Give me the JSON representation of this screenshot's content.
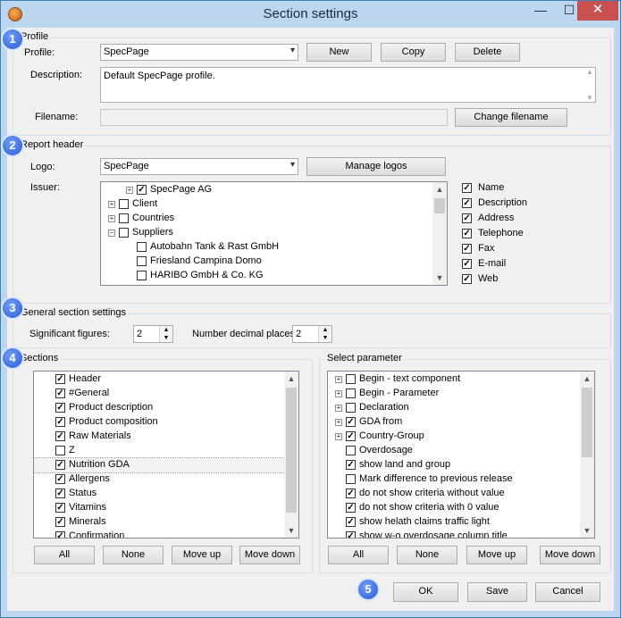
{
  "window": {
    "title": "Section settings",
    "minimize": "—",
    "maximize": "☐",
    "close": "✕"
  },
  "badges": [
    "1",
    "2",
    "3",
    "4",
    "5"
  ],
  "profile": {
    "group_label": "Profile",
    "profile_label": "Profile:",
    "profile_value": "SpecPage",
    "new_label": "New",
    "copy_label": "Copy",
    "delete_label": "Delete",
    "description_label": "Description:",
    "description_value": "Default SpecPage profile.",
    "filename_label": "Filename:",
    "filename_value": "",
    "change_filename_label": "Change filename"
  },
  "report_header": {
    "group_label": "Report header",
    "logo_label": "Logo:",
    "logo_value": "SpecPage",
    "manage_logos_label": "Manage logos",
    "issuer_label": "Issuer:",
    "issuer_tree": [
      {
        "label": "SpecPage AG",
        "checked": true,
        "expander": "+",
        "indent": 1
      },
      {
        "label": "Client",
        "checked": false,
        "expander": "+",
        "indent": 0
      },
      {
        "label": "Countries",
        "checked": false,
        "expander": "+",
        "indent": 0
      },
      {
        "label": "Suppliers",
        "checked": false,
        "expander": "−",
        "indent": 0
      },
      {
        "label": "Autobahn Tank & Rast GmbH",
        "checked": false,
        "expander": "",
        "indent": 1
      },
      {
        "label": "Friesland Campina Domo",
        "checked": false,
        "expander": "",
        "indent": 1
      },
      {
        "label": "HARIBO GmbH & Co. KG",
        "checked": false,
        "expander": "",
        "indent": 1
      }
    ],
    "fields": [
      {
        "label": "Name",
        "checked": true
      },
      {
        "label": "Description",
        "checked": true
      },
      {
        "label": "Address",
        "checked": true
      },
      {
        "label": "Telephone",
        "checked": true
      },
      {
        "label": "Fax",
        "checked": true
      },
      {
        "label": "E-mail",
        "checked": true
      },
      {
        "label": "Web",
        "checked": true
      }
    ]
  },
  "general": {
    "group_label": "General section settings",
    "sig_label": "Significant figures:",
    "sig_value": "2",
    "dec_label": "Number decimal places:",
    "dec_value": "2"
  },
  "sections": {
    "group_label": "Sections",
    "items": [
      {
        "label": "Header",
        "checked": true
      },
      {
        "label": "#General",
        "checked": true
      },
      {
        "label": "Product description",
        "checked": true
      },
      {
        "label": "Product composition",
        "checked": true
      },
      {
        "label": "Raw Materials",
        "checked": true
      },
      {
        "label": "Z",
        "checked": false
      },
      {
        "label": "Nutrition GDA",
        "checked": true,
        "selected": true
      },
      {
        "label": "Allergens",
        "checked": true
      },
      {
        "label": "Status",
        "checked": true
      },
      {
        "label": "Vitamins",
        "checked": true
      },
      {
        "label": "Minerals",
        "checked": true
      },
      {
        "label": "Confirmation",
        "checked": true
      }
    ],
    "all_label": "All",
    "none_label": "None",
    "move_up_label": "Move up",
    "move_down_label": "Move down"
  },
  "parameters": {
    "group_label": "Select parameter",
    "items": [
      {
        "label": "Begin - text component",
        "checked": false,
        "expander": "+"
      },
      {
        "label": "Begin - Parameter",
        "checked": false,
        "expander": "+"
      },
      {
        "label": "Declaration",
        "checked": false,
        "expander": "+"
      },
      {
        "label": "GDA from",
        "checked": true,
        "expander": "+"
      },
      {
        "label": "Country-Group",
        "checked": true,
        "expander": "+"
      },
      {
        "label": "Overdosage",
        "checked": false,
        "expander": ""
      },
      {
        "label": "show land and group",
        "checked": true,
        "expander": ""
      },
      {
        "label": "Mark difference to previous release",
        "checked": false,
        "expander": ""
      },
      {
        "label": "do not show criteria without value",
        "checked": true,
        "expander": ""
      },
      {
        "label": "do not show criteria with 0 value",
        "checked": true,
        "expander": ""
      },
      {
        "label": "show helath claims traffic light",
        "checked": true,
        "expander": ""
      },
      {
        "label": "show w-o overdosage column title",
        "checked": true,
        "expander": ""
      }
    ],
    "all_label": "All",
    "none_label": "None",
    "move_up_label": "Move up",
    "move_down_label": "Move down"
  },
  "footer": {
    "ok_label": "OK",
    "save_label": "Save",
    "cancel_label": "Cancel"
  }
}
